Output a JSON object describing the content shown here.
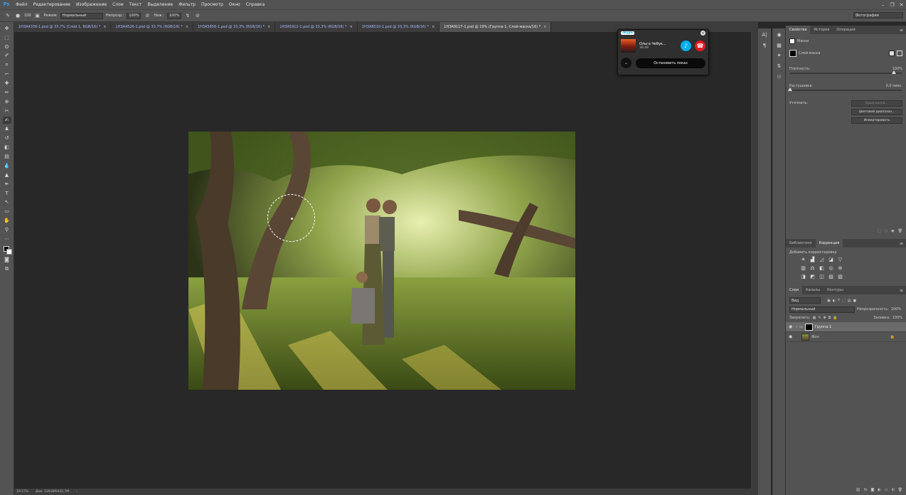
{
  "app": {
    "logo": "Ps"
  },
  "menu": [
    "Файл",
    "Редактирование",
    "Изображение",
    "Слои",
    "Текст",
    "Выделение",
    "Фильтр",
    "Просмотр",
    "Окно",
    "Справка"
  ],
  "options": {
    "size": "100",
    "mode_label": "Режим:",
    "mode_value": "Нормальный",
    "opacity_label": "Непрозр.:",
    "opacity_value": "100%",
    "flow_label": "Наж.:",
    "flow_value": "100%",
    "workspace": "Фотография"
  },
  "tabs": [
    {
      "name": "1H3A4336-1.psd @ 33,7% (Слой 1, RGB/16) *",
      "active": false
    },
    {
      "name": "1H3A4526-1.psd @ 33,7% (RGB/16) *",
      "active": false
    },
    {
      "name": "1H3A5856-1.psd @ 33,3% (RGB/16) *",
      "active": false
    },
    {
      "name": "1H3A5912-1.psd @ 33,3% (RGB/16) *",
      "active": false
    },
    {
      "name": "1H3A8010-1.psd @ 33,3% (RGB/16) *",
      "active": false
    },
    {
      "name": "1H3A9117-1.psd @ 19% (Группа 1, Слой-маска/16) *",
      "active": true
    }
  ],
  "status": {
    "zoom": "19,57%",
    "doc": "Док: 126,6M/435,7M"
  },
  "skype": {
    "logo": "skype",
    "caller_name": "Ольга Чебук...",
    "call_time": "36:49",
    "stop_button": "Остановить показ"
  },
  "properties_panel": {
    "tabs": [
      "Свойства",
      "История",
      "Операции"
    ],
    "active_tab": 0,
    "section": "Маски",
    "mask_type": "Слой-маска",
    "density_label": "Плотность:",
    "density_value": "100%",
    "density_fraction": 1.0,
    "feather_label": "Растушевка:",
    "feather_value": "0,0 пикс.",
    "feather_fraction": 0.0,
    "refine_label": "Уточнить:",
    "buttons": [
      "Край маски...",
      "Цветовой диапазон...",
      "Инвертировать"
    ]
  },
  "adjustments_panel": {
    "tabs": [
      "Библиотеки",
      "Коррекция"
    ],
    "active_tab": 1,
    "title": "Добавить корректировку"
  },
  "layers_panel": {
    "tabs": [
      "Слои",
      "Каналы",
      "Контуры"
    ],
    "active_tab": 0,
    "filter": "Вид",
    "blend_mode": "Нормальный",
    "opacity_label": "Непрозрачность:",
    "opacity_value": "100%",
    "lock_label": "Закрепить:",
    "fill_label": "Заливка:",
    "fill_value": "100%",
    "layers": [
      {
        "name": "Группа 1",
        "selected": true,
        "type": "group"
      },
      {
        "name": "Фон",
        "selected": false,
        "type": "background"
      }
    ]
  }
}
